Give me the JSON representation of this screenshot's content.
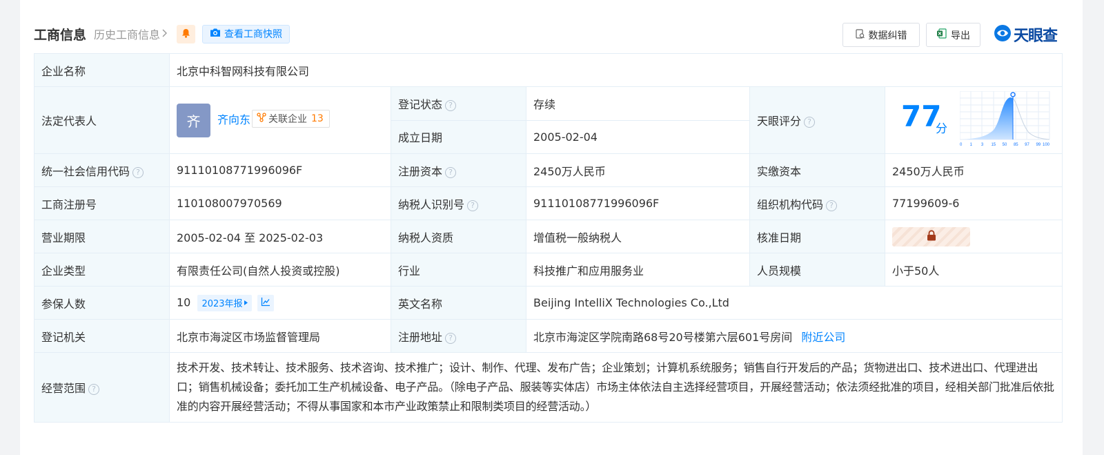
{
  "header": {
    "title": "工商信息",
    "history_link": "历史工商信息",
    "snapshot_button": "查看工商快照",
    "error_button": "数据纠错",
    "export_button": "导出",
    "logo_text": "天眼查"
  },
  "rows": {
    "company_name_label": "企业名称",
    "company_name": "北京中科智网科技有限公司",
    "legal_rep_label": "法定代表人",
    "legal_rep_avatar": "齐",
    "legal_rep_name": "齐向东",
    "related_companies_label": "关联企业",
    "related_companies_count": "13",
    "reg_status_label": "登记状态",
    "reg_status": "存续",
    "est_date_label": "成立日期",
    "est_date": "2005-02-04",
    "score_label": "天眼评分",
    "score": "77",
    "score_unit": "分",
    "score_axis": [
      "0",
      "1",
      "3",
      "15",
      "50",
      "85",
      "97",
      "99",
      "100"
    ],
    "credit_code_label": "统一社会信用代码",
    "credit_code": "91110108771996096F",
    "reg_capital_label": "注册资本",
    "reg_capital": "2450万人民币",
    "paid_capital_label": "实缴资本",
    "paid_capital": "2450万人民币",
    "biz_reg_no_label": "工商注册号",
    "biz_reg_no": "110108007970569",
    "taxpayer_id_label": "纳税人识别号",
    "taxpayer_id": "91110108771996096F",
    "org_code_label": "组织机构代码",
    "org_code": "77199609-6",
    "term_label": "营业期限",
    "term": "2005-02-04 至 2025-02-03",
    "taxpayer_qual_label": "纳税人资质",
    "taxpayer_qual": "增值税一般纳税人",
    "approval_date_label": "核准日期",
    "company_type_label": "企业类型",
    "company_type": "有限责任公司(自然人投资或控股)",
    "industry_label": "行业",
    "industry": "科技推广和应用服务业",
    "staff_size_label": "人员规模",
    "staff_size": "小于50人",
    "insured_label": "参保人数",
    "insured": "10",
    "insured_year_tag": "2023年报",
    "english_name_label": "英文名称",
    "english_name": "Beijing IntelliX Technologies Co.,Ltd",
    "reg_authority_label": "登记机关",
    "reg_authority": "北京市海淀区市场监督管理局",
    "reg_address_label": "注册地址",
    "reg_address": "北京市海淀区学院南路68号20号楼第六层601号房间",
    "nearby_link": "附近公司",
    "scope_label": "经营范围",
    "scope": "技术开发、技术转让、技术服务、技术咨询、技术推广；设计、制作、代理、发布广告；企业策划；计算机系统服务；销售自行开发后的产品；货物进出口、技术进出口、代理进出口；销售机械设备；委托加工生产机械设备、电子产品。（除电子产品、服装等实体店）市场主体依法自主选择经营项目，开展经营活动；依法须经批准的项目，经相关部门批准后依批准的内容开展经营活动；不得从事国家和本市产业政策禁止和限制类项目的经营活动。）"
  },
  "colors": {
    "accent": "#0084ff",
    "status_green": "#009944",
    "label_bg": "#f2f9fc",
    "count_orange": "#ff7a00"
  },
  "icons": [
    "bell-icon",
    "camera-icon",
    "chevron-right-icon",
    "error-report-icon",
    "excel-icon",
    "tianyancha-logo-icon",
    "help-icon",
    "relation-icon",
    "lock-icon",
    "play-icon",
    "trend-icon",
    "score-chart-icon"
  ]
}
